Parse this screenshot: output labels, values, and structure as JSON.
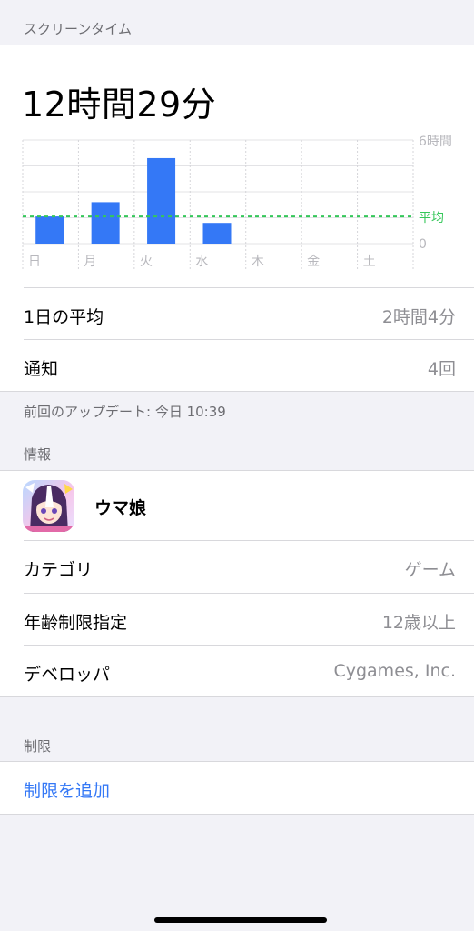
{
  "screen_time": {
    "section_title": "スクリーンタイム",
    "total": "12時間29分",
    "daily_average_label": "1日の平均",
    "daily_average_value": "2時間4分",
    "notifications_label": "通知",
    "notifications_value": "4回",
    "last_update": "前回のアップデート: 今日 10:39"
  },
  "chart_data": {
    "type": "bar",
    "categories": [
      "日",
      "月",
      "火",
      "水",
      "木",
      "金",
      "土"
    ],
    "values": [
      2.1,
      3.2,
      6.6,
      1.6,
      0,
      0,
      0
    ],
    "average": 2.1,
    "average_label": "平均",
    "y_top_label": "6時間",
    "y_bottom_label": "0",
    "ylim": [
      0,
      8
    ],
    "grid": true,
    "bar_color": "#3478f6",
    "average_color": "#34c759"
  },
  "info": {
    "section_title": "情報",
    "app_name": "ウマ娘",
    "category_label": "カテゴリ",
    "category_value": "ゲーム",
    "age_label": "年齢制限指定",
    "age_value": "12歳以上",
    "developer_label": "デベロッパ",
    "developer_value": "Cygames, Inc."
  },
  "limits": {
    "section_title": "制限",
    "add_limit": "制限を追加"
  }
}
